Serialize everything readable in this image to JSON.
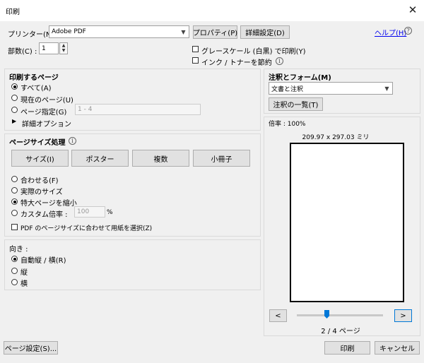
{
  "window": {
    "title": "印刷",
    "close_glyph": "✕"
  },
  "printer": {
    "label": "プリンター(N) :",
    "value": "Adobe PDF",
    "properties_button": "プロパティ(P)",
    "advanced_button": "詳細設定(D)"
  },
  "help": {
    "link": "ヘルプ(H)",
    "icon": "question-icon"
  },
  "copies": {
    "label": "部数(C) :",
    "value": "1"
  },
  "options": {
    "grayscale": "グレースケール (白黒) で印刷(Y)",
    "save_ink": "インク / トナーを節約"
  },
  "pages_to_print": {
    "heading": "印刷するページ",
    "all": "すべて(A)",
    "current": "現在のページ(U)",
    "pages": "ページ指定(G)",
    "pages_value": "1 - 4",
    "more_options": "詳細オプション",
    "selected": "all"
  },
  "page_sizing": {
    "heading": "ページサイズ処理",
    "tabs": [
      "サイズ(I)",
      "ポスター",
      "複数",
      "小冊子"
    ],
    "fit": "合わせる(F)",
    "actual": "実際のサイズ",
    "shrink": "特大ページを縮小",
    "custom": "カスタム倍率 :",
    "custom_value": "100",
    "percent": "%",
    "choose_paper": "PDF のページサイズに合わせて用紙を選択(Z)",
    "selected": "shrink"
  },
  "orientation": {
    "heading": "向き :",
    "auto": "自動縦 / 横(R)",
    "portrait": "縦",
    "landscape": "横",
    "selected": "auto"
  },
  "comments": {
    "heading": "注釈とフォーム(M)",
    "value": "文書と注釈",
    "summarize_button": "注釈の一覧(T)"
  },
  "preview": {
    "scale": "倍率 : 100%",
    "dimensions": "209.97 x 297.03 ミリ",
    "prev_button": "<",
    "next_button": ">",
    "page_indicator": "2 / 4 ページ",
    "current_page": 2,
    "total_pages": 4
  },
  "footer": {
    "page_setup_button": "ページ設定(S)...",
    "print_button": "印刷",
    "cancel_button": "キャンセル"
  },
  "colors": {
    "accent": "#0078d7",
    "link": "#0000ee",
    "radio_mark": "#000000"
  }
}
